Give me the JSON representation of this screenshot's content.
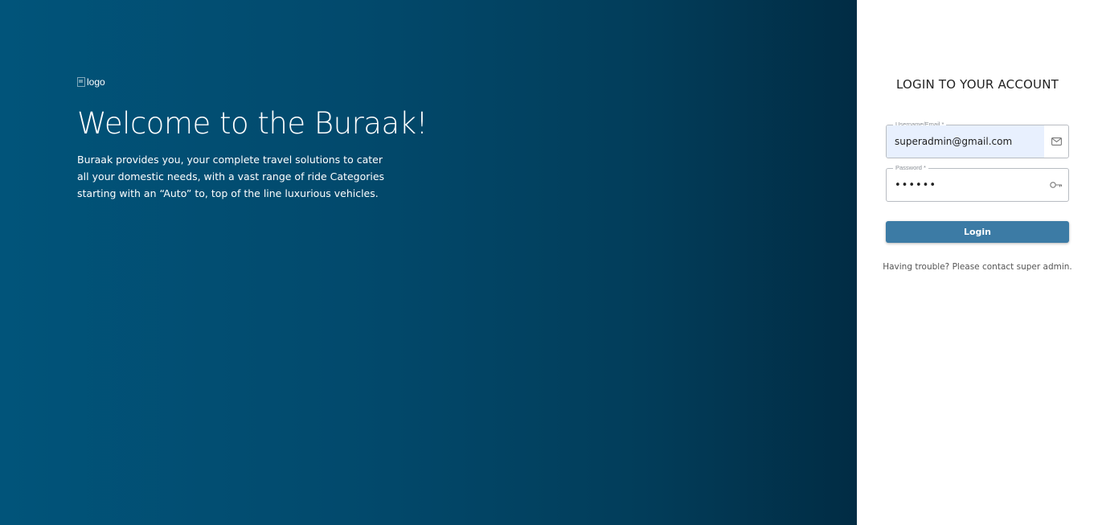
{
  "hero": {
    "logo_alt": "logo",
    "headline": "Welcome to the Buraak!",
    "description": "Buraak provides you, your complete travel solutions to cater all your domestic needs, with a vast range of ride Categories starting with an “Auto” to, top of the line luxurious vehicles.",
    "gradient_colors": [
      "#01547a",
      "#012c44"
    ]
  },
  "login_panel": {
    "title": "LOGIN TO YOUR ACCOUNT",
    "email_field": {
      "label": "Username/Email *",
      "value": "superadmin@gmail.com",
      "icon": "mail-icon"
    },
    "password_field": {
      "label": "Password *",
      "value": "••••••",
      "icon": "key-icon"
    },
    "login_button": {
      "label": "Login",
      "color": "#3c7ba5"
    },
    "help_text": "Having trouble? Please contact super admin."
  }
}
